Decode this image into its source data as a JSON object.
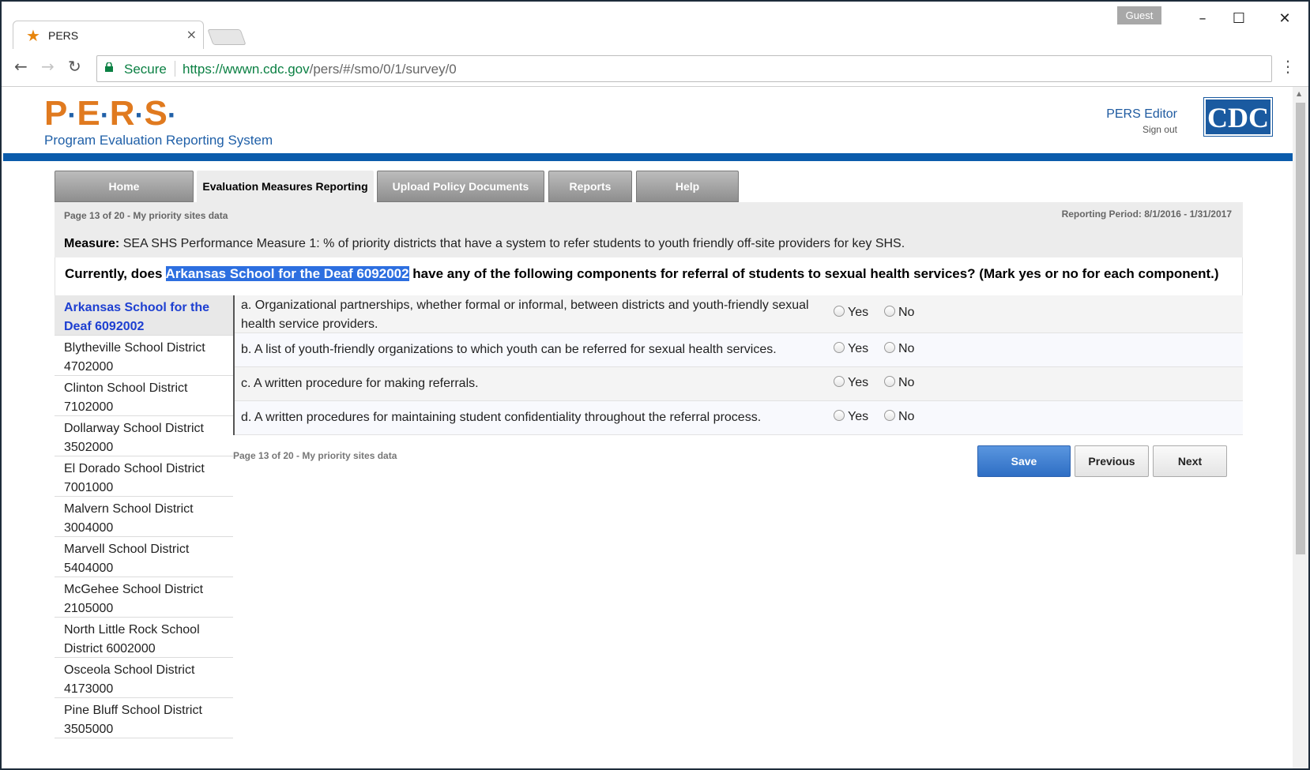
{
  "browser": {
    "tab_title": "PERS",
    "tab_close": "×",
    "profile": "Guest",
    "secure_label": "Secure",
    "url_host": "https://wwwn.cdc.gov",
    "url_path": "/pers/#/smo/0/1/survey/0"
  },
  "header": {
    "logo_letters": [
      "P",
      "E",
      "R",
      "S"
    ],
    "logo_subtitle": "Program Evaluation Reporting System",
    "user_name": "PERS Editor",
    "sign_out": "Sign out",
    "agency_logo": "CDC"
  },
  "nav": {
    "tabs": [
      {
        "label": "Home",
        "active": false
      },
      {
        "label": "Evaluation Measures Reporting",
        "active": true
      },
      {
        "label": "Upload Policy Documents",
        "active": false
      },
      {
        "label": "Reports",
        "active": false
      },
      {
        "label": "Help",
        "active": false
      }
    ]
  },
  "survey": {
    "page_label": "Page 13 of 20 - My priority sites data",
    "reporting_period": "Reporting Period: 8/1/2016 - 1/31/2017",
    "measure_label": "Measure:",
    "measure_text": "SEA SHS Performance Measure 1: % of priority districts that have a system to refer students to youth friendly off-site providers for key SHS.",
    "question_prefix": "Currently, does",
    "question_site": "Arkansas School for the Deaf 6092002",
    "question_suffix": "have any of the following components for referral of students to sexual health services? (Mark yes or no for each component.)",
    "items": [
      {
        "text": "a. Organizational partnerships, whether formal or informal, between districts and youth-friendly sexual health service providers.",
        "yes": "Yes",
        "no": "No"
      },
      {
        "text": "b. A list of youth-friendly organizations to which youth can be referred for sexual health services.",
        "yes": "Yes",
        "no": "No"
      },
      {
        "text": "c. A written procedure for making referrals.",
        "yes": "Yes",
        "no": "No"
      },
      {
        "text": "d. A written procedures for maintaining student confidentiality throughout the referral process.",
        "yes": "Yes",
        "no": "No"
      }
    ],
    "footer_label": "Page 13 of 20 - My priority sites data",
    "buttons": {
      "save": "Save",
      "previous": "Previous",
      "next": "Next"
    }
  },
  "sites": [
    {
      "line1": "Arkansas School for the",
      "line2": "Deaf 6092002",
      "active": true
    },
    {
      "line1": "Blytheville School District",
      "line2": "4702000",
      "active": false
    },
    {
      "line1": "Clinton School District",
      "line2": "7102000",
      "active": false
    },
    {
      "line1": "Dollarway School District",
      "line2": "3502000",
      "active": false
    },
    {
      "line1": "El Dorado School District",
      "line2": "7001000",
      "active": false
    },
    {
      "line1": "Malvern School District",
      "line2": "3004000",
      "active": false
    },
    {
      "line1": "Marvell School District",
      "line2": "5404000",
      "active": false
    },
    {
      "line1": "McGehee School District",
      "line2": "2105000",
      "active": false
    },
    {
      "line1": "North Little Rock School",
      "line2": "District 6002000",
      "active": false
    },
    {
      "line1": "Osceola School District",
      "line2": "4173000",
      "active": false
    },
    {
      "line1": "Pine Bluff School District",
      "line2": "3505000",
      "active": false
    }
  ],
  "colors": {
    "brand_orange": "#e07a1f",
    "brand_blue": "#0b5bab",
    "save_blue": "#2e6ec4",
    "highlight": "#2d6fe0"
  }
}
